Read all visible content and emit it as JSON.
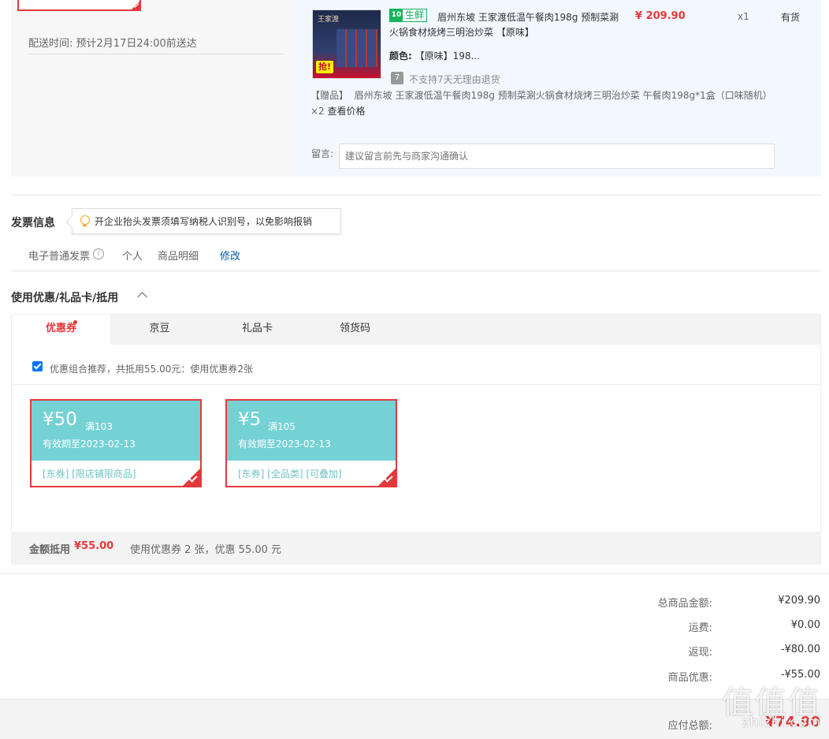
{
  "delivery": {
    "time_label": "配送时间:",
    "time_value": "预计2月17日24:00前送达"
  },
  "product": {
    "fresh_tag": "生鲜",
    "fresh_icon": "10",
    "thumb_brand": "王家渡",
    "thumb_badge": "抢!",
    "name": "眉州东坡 王家渡低温午餐肉198g 预制菜涮火锅食材烧烤三明治炒菜 【原味】",
    "color_label": "颜色:",
    "color_value": "【原味】198...",
    "price": "¥ 209.90",
    "qty": "x1",
    "stock": "有货",
    "return_icon": "7",
    "return_policy": "不支持7天无理由退货",
    "gift_prefix": "【赠品】",
    "gift_text": "眉州东坡 王家渡低温午餐肉198g 预制菜涮火锅食材烧烤三明治炒菜 午餐肉198g*1盒（口味随机）",
    "gift_count": "×2",
    "gift_check_price": "查看价格",
    "memo_label": "留言:",
    "memo_placeholder": "建议留言前先与商家沟通确认"
  },
  "invoice": {
    "title": "发票信息",
    "tip": "开企业抬头发票须填写纳税人识别号，以免影响报销",
    "type": "电子普通发票",
    "info_icon": "i",
    "person": "个人",
    "detail": "商品明细",
    "edit": "修改"
  },
  "coupons": {
    "title": "使用优惠/礼品卡/抵用",
    "tabs": [
      "优惠券",
      "京豆",
      "礼品卡",
      "领货码"
    ],
    "combo_text": "优惠组合推荐，共抵用55.00元：使用优惠券2张",
    "items": [
      {
        "amount": "¥50",
        "condition": "满103",
        "valid": "有效期至2023-02-13",
        "tags": "[东券] [限店铺限商品]"
      },
      {
        "amount": "¥5",
        "condition": "满105",
        "valid": "有效期至2023-02-13",
        "tags": "[东券] [全品类] [可叠加]"
      }
    ],
    "summary_label": "金额抵用",
    "summary_amount": "¥55.00",
    "summary_desc": "使用优惠券 2 张，优惠 55.00 元"
  },
  "totals": {
    "rows": [
      {
        "label": "总商品金额:",
        "value": "¥209.90"
      },
      {
        "label": "运费:",
        "value": "¥0.00"
      },
      {
        "label": "返现:",
        "value": "-¥80.00"
      },
      {
        "label": "商品优惠:",
        "value": "-¥55.00"
      }
    ],
    "pay_label": "应付总额:",
    "pay_value": "¥74.90"
  },
  "watermark": {
    "glyphs": "值值值",
    "site": "zhizhi.com"
  },
  "colors": {
    "accent_red": "#e4393c",
    "coupon_teal": "#74d2d5",
    "fresh_green": "#18b35a",
    "link_blue": "#005ea7"
  }
}
